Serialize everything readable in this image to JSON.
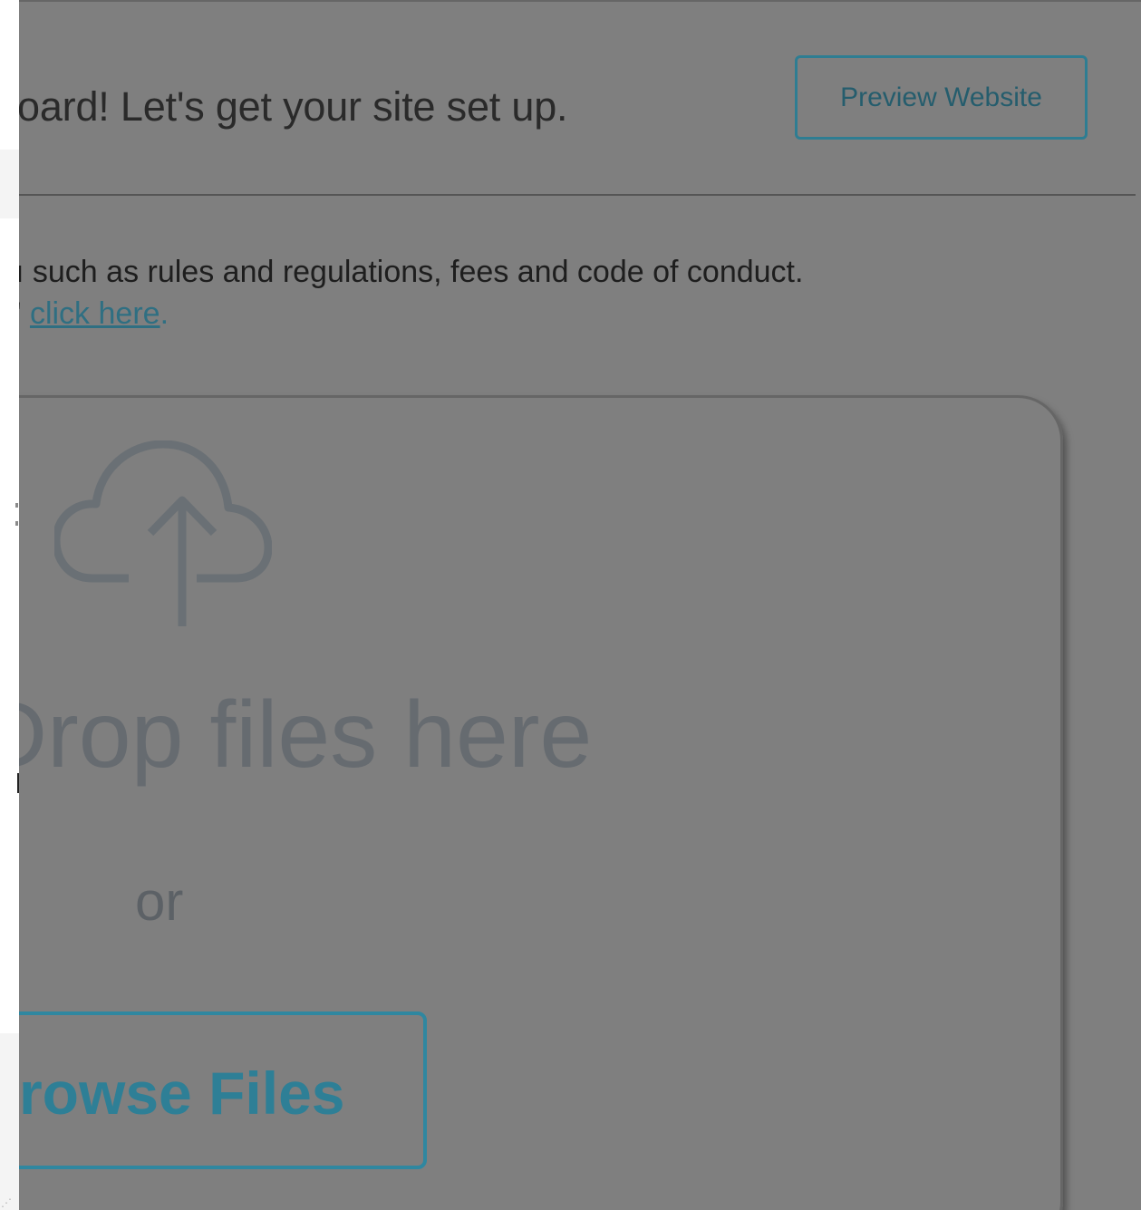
{
  "header": {
    "welcome_text": "oard! Let's get your site set up.",
    "preview_button_label": "Preview Website"
  },
  "info": {
    "description": "ı such as rules and regulations, fees and code of conduct.",
    "link_lead": "'",
    "link_text": "click here",
    "link_trailing": "."
  },
  "dropzone": {
    "icon": "cloud-upload-icon",
    "drop_text": "Drop files here",
    "or_text": "or",
    "browse_button_label": "rowse Files"
  },
  "colors": {
    "overlay_gray": "#7f7f7f",
    "accent_teal": "#2f87a0",
    "link": "#2f6f82"
  }
}
